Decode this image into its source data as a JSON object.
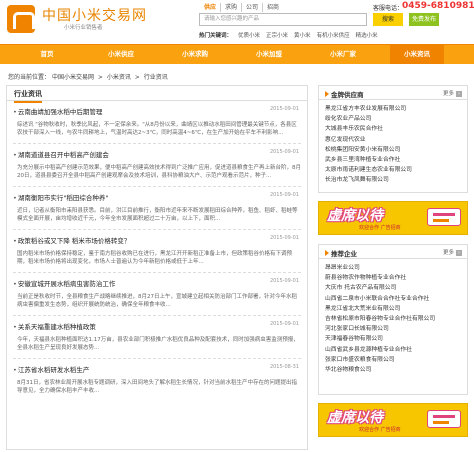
{
  "header": {
    "logo_title": "中国小米交易网",
    "logo_subtitle": "小米行业销售者",
    "search_tabs": [
      "供应",
      "求购",
      "公司",
      "招商"
    ],
    "search_placeholder": "请输入您感兴趣的产品",
    "search_button": "搜索",
    "hotline_label": "客服电话：",
    "hotline_number": "0459-6810981",
    "publish_button": "免费发布",
    "hot_search_label": "热门关键词：",
    "hot_search": [
      "优质小米",
      "正宗小米",
      "黄小米",
      "有机小米供应",
      "精选小米"
    ]
  },
  "nav": {
    "items": [
      "首页",
      "小米供应",
      "小米求购",
      "小米加盟",
      "小米厂家",
      "小米资讯"
    ],
    "active_index": 5
  },
  "breadcrumb": {
    "prefix": "您的当前位置：",
    "items": [
      "中国小米交易网",
      "小米资讯",
      "行业资讯"
    ]
  },
  "news": {
    "title": "行业资讯",
    "items": [
      {
        "title": "云南曲靖加强水稻中后期管理",
        "date": "2015-09-01",
        "summary": "综述讯 \"谷物秋收时，秋季比风起，不一定保余来。\"从8月份以来，曲靖区以推动水稻田间管理最关键节点，各县区农技干部深入一线，与农牛同耕地上，气温时高达2~3℃，同时高温4~6℃，在生产加开始在平车不利影响..."
      },
      {
        "title": "湖南道道县召开中稻高产创建会",
        "date": "2015-09-01",
        "summary": "为充分展示中稻高产创建示范效果，便中稻高产创建高效技术得到广泛推广应用，促进道县粮食生产再上新台阶，8月20日，道县县委召开全县中稻高产创建观摩会及技术培训，县科协粮油大户、示范户观看示范片，种子..."
      },
      {
        "title": "湖南衡阳市实行\"稻田综合种养\"",
        "date": "2015-09-01",
        "summary": "近日，记者从衡阳市耒阳县获悉。目前，洪江目前推行，衡阳市近年来不断发展稻田综合种养，稻鱼、稻虾、稻蛙等模式全面开展，亩均增收近千元，今年全市发展面积超过二十万亩，以上下，面积..."
      },
      {
        "title": "政策稻谷或又下降  稻米市场价格转变？",
        "date": "2015-09-01",
        "summary": "国内稻米市场价格保持稳定，鉴于南方稻谷收购已在进行，黑龙江开开新稻正准备上市，但政策稻谷价格有下调预期，稻米市场价格将出现变化，市场人士普遍认为今年新稻价格或低于上年..."
      },
      {
        "title": "安徽宣城开展水稻病虫害防治工作",
        "date": "2015-09-01",
        "summary": "当前正是秋收时节，全县粮食生产战略继续推进，8月27日上午，宣城建立起相关防治部门工作部署，针对今年水稻病虫害偏重发生态势，组织开展统防统治，确保全年粮食丰收..."
      },
      {
        "title": "关系天福重建水稻种植政策",
        "date": "2015-09-01",
        "summary": "今年，天福县水稻种植面积达1.17万亩，县农业部门积极推广水稻优良品种及配套技术，同时加强病虫害监测预报，全县水稻生产呈现良好发展态势..."
      },
      {
        "title": "江苏省水稻研发水稻生产",
        "date": "2015-08-31",
        "summary": "8月31日，省农林业局开展水稻专题调研，深入田间地头了解水稻生长情况，针对当前水稻生产中存在的问题提出指导意见，全力确保水稻丰产丰收..."
      }
    ]
  },
  "suppliers": {
    "title": "金牌供应商",
    "more": "更多",
    "items": [
      "黑龙江省方丰农业发展有限公司",
      "绥化农业产品公司",
      "大城县丰乐农民合作社",
      "惠亿发现代农业",
      "松桃集团阳安黄小米有限公司",
      "武乡县三里湾种植专业合作社",
      "太原市雨诺利建生态农业有限公司",
      "长治市龙飞凤舞有限公司"
    ]
  },
  "recommended": {
    "title": "推荐企业",
    "more": "更多",
    "items": [
      "昂昂米业公司",
      "蔚县谷物农作物种植专业合作社",
      "大庆市 托古农产品有限公司",
      "山西省二泉市小米联合合作社专业合作社",
      "黑龙江省北大荒米业有限公司",
      "吉林省松原市阳春谷物专业合作社有限公司",
      "河北张家口长城有限公司",
      "天津福春谷物有限公司",
      "山西省武乡县龙源种植专业合作社",
      "张家口市盛农粮食有限公司",
      "华北谷物粮食公司"
    ]
  },
  "ads": {
    "main": "虚席以待",
    "sub": "欢迎合作 广告招商"
  },
  "colors": {
    "brand": "#f08300",
    "nav_bg": "#f9a10f",
    "hotline": "#e33333",
    "publish": "#8dc21f",
    "ad_bg": "#f7c600"
  }
}
